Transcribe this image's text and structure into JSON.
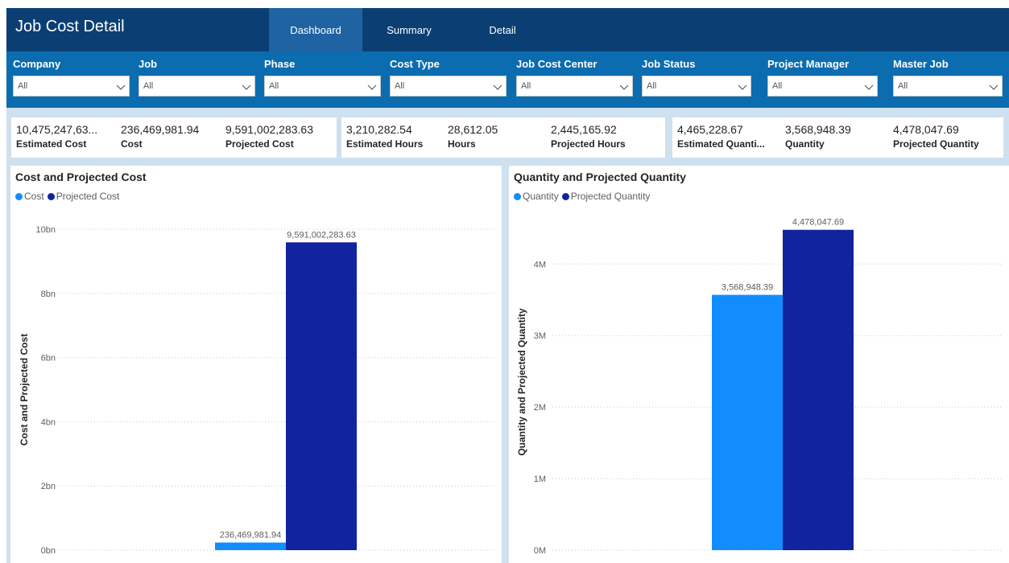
{
  "app": {
    "title": "Job Cost Detail",
    "tabs": [
      {
        "label": "Dashboard",
        "active": true
      },
      {
        "label": "Summary",
        "active": false
      },
      {
        "label": "Detail",
        "active": false
      }
    ]
  },
  "filters": [
    {
      "label": "Company",
      "value": "All"
    },
    {
      "label": "Job",
      "value": "All"
    },
    {
      "label": "Phase",
      "value": "All"
    },
    {
      "label": "Cost Type",
      "value": "All"
    },
    {
      "label": "Job Cost Center",
      "value": "All"
    },
    {
      "label": "Job Status",
      "value": "All"
    },
    {
      "label": "Project Manager",
      "value": "All"
    },
    {
      "label": "Master Job",
      "value": "All"
    }
  ],
  "kpis": [
    {
      "value": "10,475,247,63...",
      "label": "Estimated Cost"
    },
    {
      "value": "236,469,981.94",
      "label": "Cost"
    },
    {
      "value": "9,591,002,283.63",
      "label": "Projected Cost"
    },
    {
      "value": "3,210,282.54",
      "label": "Estimated Hours"
    },
    {
      "value": "28,612.05",
      "label": "Hours"
    },
    {
      "value": "2,445,165.92",
      "label": "Projected Hours"
    },
    {
      "value": "4,465,228.67",
      "label": "Estimated Quanti..."
    },
    {
      "value": "3,568,948.39",
      "label": "Quantity"
    },
    {
      "value": "4,478,047.69",
      "label": "Projected Quantity"
    }
  ],
  "colors": {
    "header_bg": "#0b3f74",
    "tab_active_bg": "#1f63a3",
    "filter_bg": "#0b6cb0",
    "canvas_bg": "#cfe0ee",
    "series_light": "#118dff",
    "series_dark": "#12239e"
  },
  "icons": {
    "dropdown": "chevron-down-icon"
  },
  "chart_data": [
    {
      "type": "bar",
      "title": "Cost and Projected Cost",
      "ylabel": "Cost and Projected Cost",
      "xlabel": "",
      "legend_position": "top-left",
      "grid": true,
      "ylim": [
        0,
        10000000000
      ],
      "ytick_values": [
        0,
        2000000000,
        4000000000,
        6000000000,
        8000000000,
        10000000000
      ],
      "ytick_labels": [
        "0bn",
        "2bn",
        "4bn",
        "6bn",
        "8bn",
        "10bn"
      ],
      "series": [
        {
          "name": "Cost",
          "values": [
            236469981.94
          ],
          "data_label": "236,469,981.94",
          "color": "#118dff"
        },
        {
          "name": "Projected Cost",
          "values": [
            9591002283.63
          ],
          "data_label": "9,591,002,283.63",
          "color": "#12239e"
        }
      ]
    },
    {
      "type": "bar",
      "title": "Quantity and Projected Quantity",
      "ylabel": "Quantity and Projected Quantity",
      "xlabel": "",
      "legend_position": "top-left",
      "grid": true,
      "ylim": [
        0,
        4700000
      ],
      "ytick_values": [
        0,
        1000000,
        2000000,
        3000000,
        4000000
      ],
      "ytick_labels": [
        "0M",
        "1M",
        "2M",
        "3M",
        "4M"
      ],
      "series": [
        {
          "name": "Quantity",
          "values": [
            3568948.39
          ],
          "data_label": "3,568,948.39",
          "color": "#118dff"
        },
        {
          "name": "Projected Quantity",
          "values": [
            4478047.69
          ],
          "data_label": "4,478,047.69",
          "color": "#12239e"
        }
      ]
    }
  ]
}
